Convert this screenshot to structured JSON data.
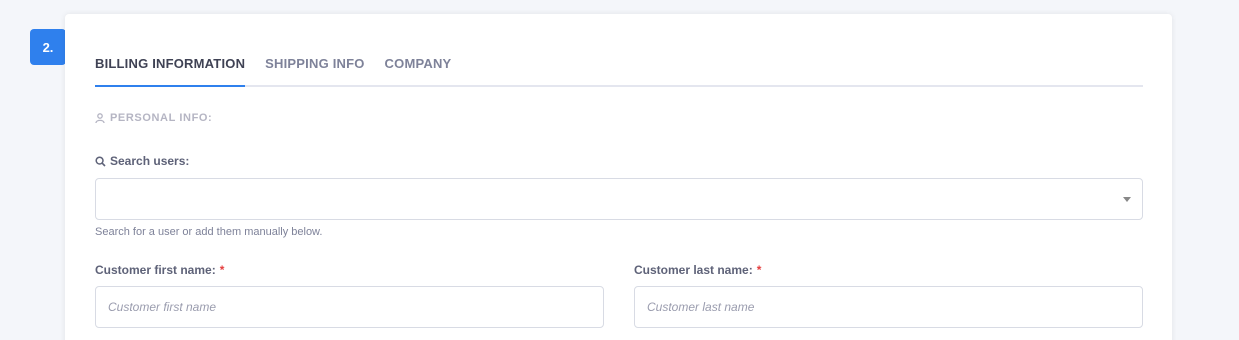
{
  "step": {
    "number": "2."
  },
  "tabs": [
    {
      "label": "BILLING INFORMATION",
      "active": true
    },
    {
      "label": "SHIPPING INFO",
      "active": false
    },
    {
      "label": "COMPANY",
      "active": false
    }
  ],
  "section": {
    "title": "PERSONAL INFO:",
    "icon": "user-icon"
  },
  "search_users": {
    "label": "Search users:",
    "icon": "search-icon",
    "selected": "",
    "help": "Search for a user or add them manually below."
  },
  "first_name": {
    "label": "Customer first name:",
    "required_mark": "*",
    "placeholder": "Customer first name",
    "value": ""
  },
  "last_name": {
    "label": "Customer last name:",
    "required_mark": "*",
    "placeholder": "Customer last name",
    "value": ""
  },
  "colors": {
    "accent": "#2f80ed",
    "required": "#e53e3e"
  }
}
